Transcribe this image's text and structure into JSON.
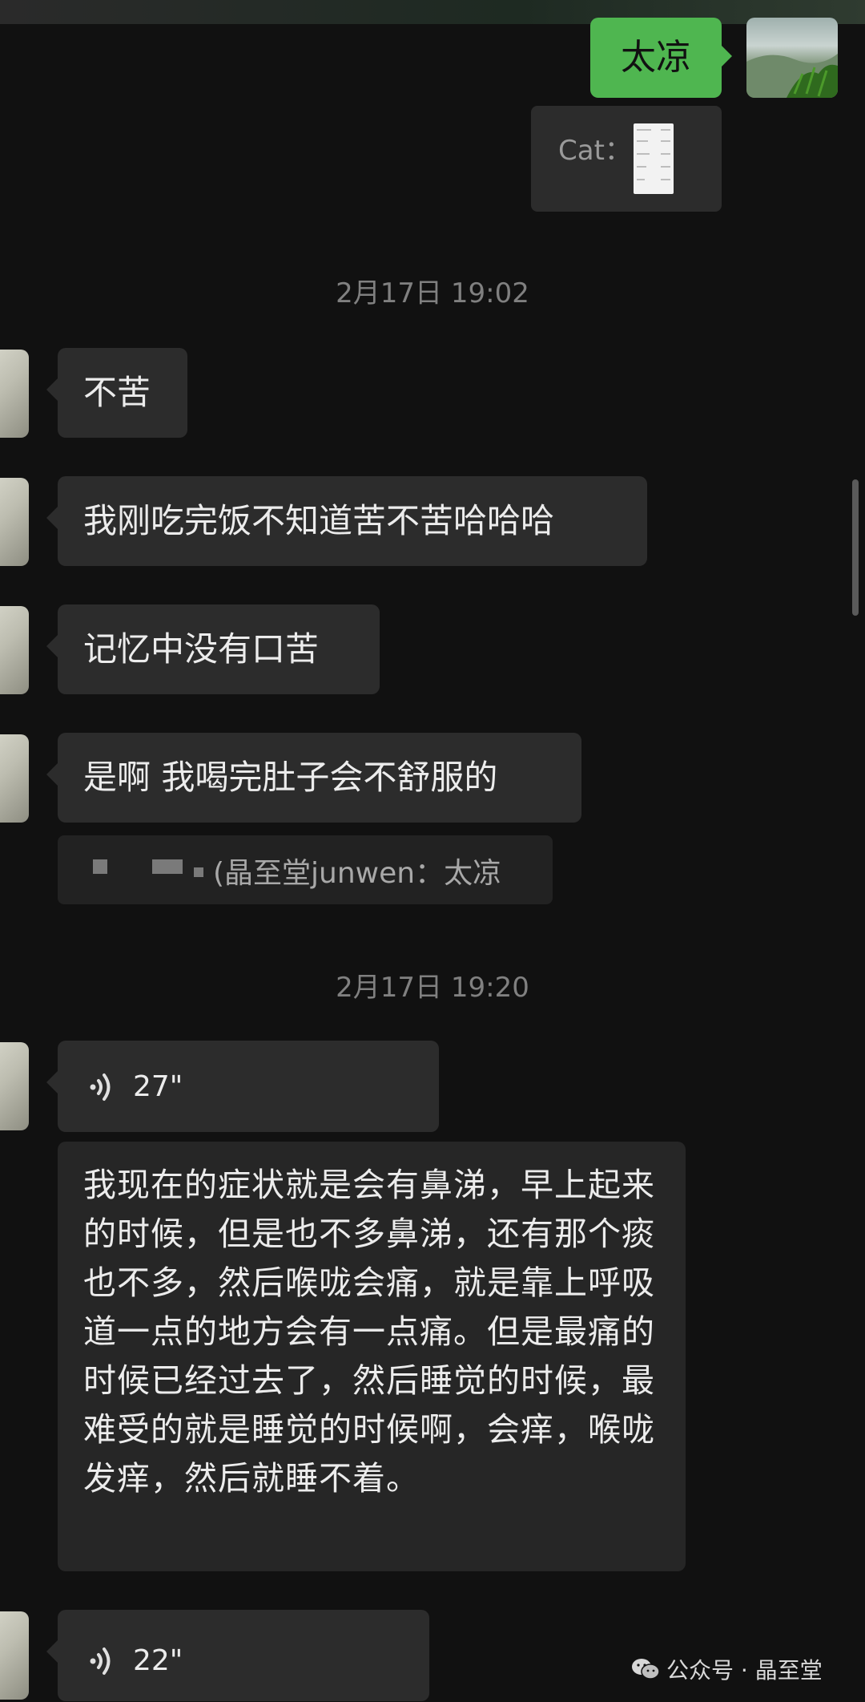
{
  "messages_top": {
    "sent_text": "太凉",
    "quote_label": "Cat："
  },
  "timestamps": [
    "2月17日 19:02",
    "2月17日 19:20"
  ],
  "incoming": [
    "不苦",
    "我刚吃完饭不知道苦不苦哈哈哈",
    "记忆中没有口苦",
    "是啊 我喝完肚子会不舒服的"
  ],
  "quote_reply": "(晶至堂junwen：太凉",
  "voice_messages": [
    {
      "duration": "27\""
    },
    {
      "duration": "22\""
    }
  ],
  "transcript": "我现在的症状就是会有鼻涕，早上起来的时候，但是也不多鼻涕，还有那个痰也不多，然后喉咙会痛，就是靠上呼吸道一点的地方会有一点痛。但是最痛的时候已经过去了，然后睡觉的时候，最难受的就是睡觉的时候啊，会痒，喉咙发痒，然后就睡不着。",
  "watermark": "公众号 · 晶至堂",
  "colors": {
    "sent_bubble": "#4fb650",
    "received_bubble": "#2c2c2c",
    "background": "#111111"
  }
}
